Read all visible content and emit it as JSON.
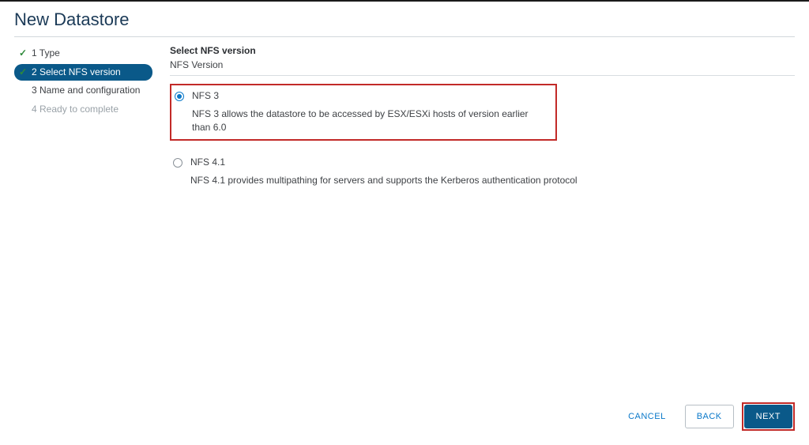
{
  "dialog": {
    "title": "New Datastore"
  },
  "steps": [
    {
      "label": "1 Type",
      "state": "done"
    },
    {
      "label": "2 Select NFS version",
      "state": "active"
    },
    {
      "label": "3 Name and configuration",
      "state": "upcoming"
    },
    {
      "label": "4 Ready to complete",
      "state": "disabled"
    }
  ],
  "form": {
    "section_title": "Select NFS version",
    "section_subtitle": "NFS Version",
    "options": [
      {
        "title": "NFS 3",
        "description": "NFS 3 allows the datastore to be accessed by ESX/ESXi hosts of version earlier than 6.0",
        "selected": true,
        "highlighted": true
      },
      {
        "title": "NFS 4.1",
        "description": "NFS 4.1 provides multipathing for servers and supports the Kerberos authentication protocol",
        "selected": false,
        "highlighted": false
      }
    ]
  },
  "buttons": {
    "cancel": "CANCEL",
    "back": "BACK",
    "next": "NEXT"
  }
}
